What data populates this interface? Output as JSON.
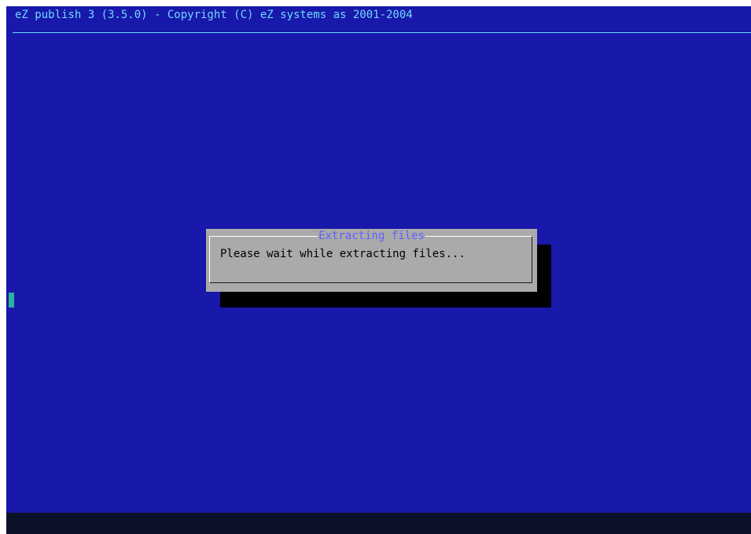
{
  "backtitle": "eZ publish 3 (3.5.0) - Copyright (C) eZ systems as 2001-2004",
  "dialog": {
    "title": "Extracting files",
    "message": "Please wait while extracting files..."
  },
  "colors": {
    "screen_background": "#1818aa",
    "backtitle_text": "#6fd8ff",
    "dialog_background": "#aaaaaa",
    "dialog_title_text": "#6060ff",
    "dialog_shadow": "#000000",
    "cursor": "#27b39b",
    "bottom_bar": "#0b1128"
  }
}
